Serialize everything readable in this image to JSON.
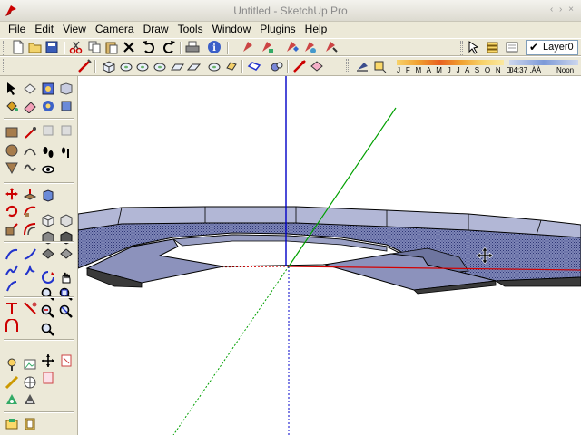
{
  "window": {
    "title": "Untitled - SketchUp Pro",
    "controls": "‹ ›  ×"
  },
  "menu": [
    {
      "id": "file",
      "label": "File",
      "key": "F",
      "rest": "ile"
    },
    {
      "id": "edit",
      "label": "Edit",
      "key": "E",
      "rest": "dit"
    },
    {
      "id": "view",
      "label": "View",
      "key": "V",
      "rest": "iew"
    },
    {
      "id": "camera",
      "label": "Camera",
      "key": "C",
      "rest": "amera"
    },
    {
      "id": "draw",
      "label": "Draw",
      "key": "D",
      "rest": "raw"
    },
    {
      "id": "tools",
      "label": "Tools",
      "key": "T",
      "rest": "ools"
    },
    {
      "id": "window",
      "label": "Window",
      "key": "W",
      "rest": "indow"
    },
    {
      "id": "plugins",
      "label": "Plugins",
      "key": "P",
      "rest": "lugins"
    },
    {
      "id": "help",
      "label": "Help",
      "key": "H",
      "rest": "elp"
    }
  ],
  "layers": {
    "current": "Layer0"
  },
  "shadows": {
    "months": "J F M A M J J A S O N D",
    "time": "04:37 ,ÀÀ",
    "noon": "Noon"
  },
  "colors": {
    "axis_red": "#d40000",
    "axis_green": "#00a000",
    "axis_blue": "#0000c8",
    "face_front": "#8a90b8",
    "face_back": "#b6bad6",
    "face_top_dots": "#4a5490",
    "edge": "#000000"
  }
}
